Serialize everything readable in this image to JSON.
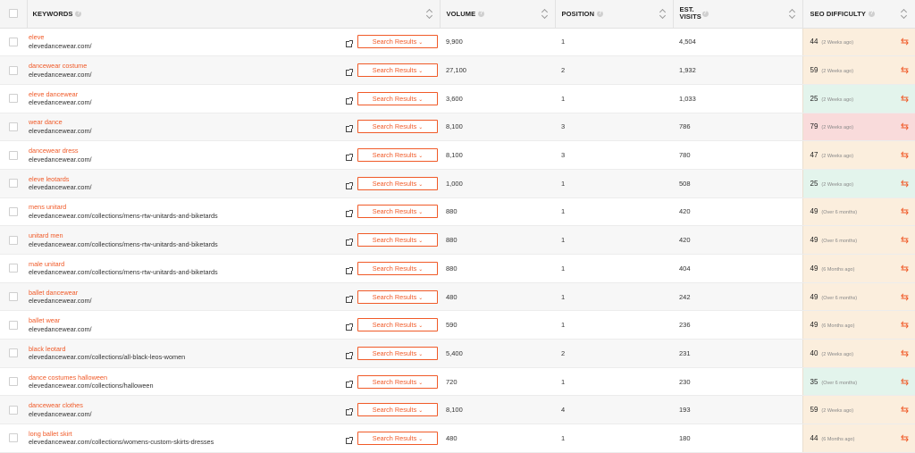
{
  "headers": {
    "keywords": "KEYWORDS",
    "volume": "VOLUME",
    "position": "POSITION",
    "visits": "EST. VISITS",
    "seo": "SEO DIFFICULTY"
  },
  "search_results_label": "Search Results",
  "colors": {
    "accent": "#f05a28",
    "seo_orange": "#fbeedd",
    "seo_green": "#e3f4ec",
    "seo_red": "#f9dbdb"
  },
  "rows": [
    {
      "keyword": "eleve",
      "url": "elevedancewear.com/",
      "volume": "9,900",
      "position": "1",
      "visits": "4,504",
      "seo": "44",
      "ago": "(2 Weeks ago)",
      "level": "orange"
    },
    {
      "keyword": "dancewear costume",
      "url": "elevedancewear.com/",
      "volume": "27,100",
      "position": "2",
      "visits": "1,932",
      "seo": "59",
      "ago": "(2 Weeks ago)",
      "level": "orange"
    },
    {
      "keyword": "eleve dancewear",
      "url": "elevedancewear.com/",
      "volume": "3,600",
      "position": "1",
      "visits": "1,033",
      "seo": "25",
      "ago": "(2 Weeks ago)",
      "level": "green"
    },
    {
      "keyword": "wear dance",
      "url": "elevedancewear.com/",
      "volume": "8,100",
      "position": "3",
      "visits": "786",
      "seo": "79",
      "ago": "(2 Weeks ago)",
      "level": "red"
    },
    {
      "keyword": "dancewear dress",
      "url": "elevedancewear.com/",
      "volume": "8,100",
      "position": "3",
      "visits": "780",
      "seo": "47",
      "ago": "(2 Weeks ago)",
      "level": "orange"
    },
    {
      "keyword": "eleve leotards",
      "url": "elevedancewear.com/",
      "volume": "1,000",
      "position": "1",
      "visits": "508",
      "seo": "25",
      "ago": "(2 Weeks ago)",
      "level": "green"
    },
    {
      "keyword": "mens unitard",
      "url": "elevedancewear.com/collections/mens-rtw-unitards-and-biketards",
      "volume": "880",
      "position": "1",
      "visits": "420",
      "seo": "49",
      "ago": "(Over 6 months)",
      "level": "orange"
    },
    {
      "keyword": "unitard men",
      "url": "elevedancewear.com/collections/mens-rtw-unitards-and-biketards",
      "volume": "880",
      "position": "1",
      "visits": "420",
      "seo": "49",
      "ago": "(Over 6 months)",
      "level": "orange"
    },
    {
      "keyword": "male unitard",
      "url": "elevedancewear.com/collections/mens-rtw-unitards-and-biketards",
      "volume": "880",
      "position": "1",
      "visits": "404",
      "seo": "49",
      "ago": "(6 Months ago)",
      "level": "orange"
    },
    {
      "keyword": "ballet dancewear",
      "url": "elevedancewear.com/",
      "volume": "480",
      "position": "1",
      "visits": "242",
      "seo": "49",
      "ago": "(Over 6 months)",
      "level": "orange"
    },
    {
      "keyword": "ballet wear",
      "url": "elevedancewear.com/",
      "volume": "590",
      "position": "1",
      "visits": "236",
      "seo": "49",
      "ago": "(6 Months ago)",
      "level": "orange"
    },
    {
      "keyword": "black leotard",
      "url": "elevedancewear.com/collections/all-black-leos-women",
      "volume": "5,400",
      "position": "2",
      "visits": "231",
      "seo": "40",
      "ago": "(2 Weeks ago)",
      "level": "orange"
    },
    {
      "keyword": "dance costumes halloween",
      "url": "elevedancewear.com/collections/halloween",
      "volume": "720",
      "position": "1",
      "visits": "230",
      "seo": "35",
      "ago": "(Over 6 months)",
      "level": "green"
    },
    {
      "keyword": "dancewear clothes",
      "url": "elevedancewear.com/",
      "volume": "8,100",
      "position": "4",
      "visits": "193",
      "seo": "59",
      "ago": "(2 Weeks ago)",
      "level": "orange"
    },
    {
      "keyword": "long ballet skirt",
      "url": "elevedancewear.com/collections/womens-custom-skirts-dresses",
      "volume": "480",
      "position": "1",
      "visits": "180",
      "seo": "44",
      "ago": "(6 Months ago)",
      "level": "orange"
    }
  ]
}
